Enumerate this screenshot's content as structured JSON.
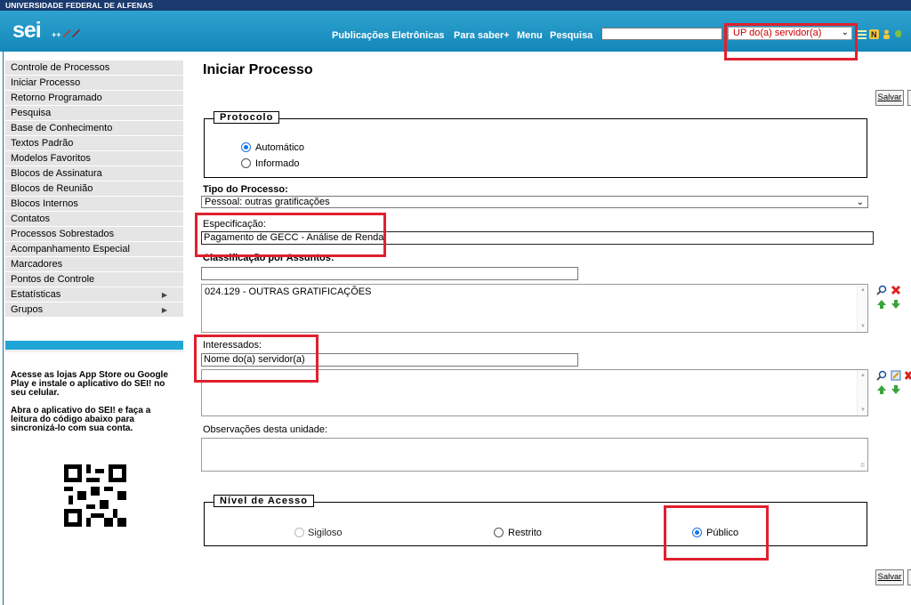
{
  "header": {
    "org_name": "UNIVERSIDADE FEDERAL DE ALFENAS",
    "logo_text": "sei",
    "logo_suffix": "++",
    "links": [
      "Publicações Eletrônicas",
      "Para saber+",
      "Menu",
      "Pesquisa"
    ],
    "search_value": "",
    "unit_selected": "UP do(a) servidor(a)"
  },
  "menu": {
    "items": [
      "Controle de Processos",
      "Iniciar Processo",
      "Retorno Programado",
      "Pesquisa",
      "Base de Conhecimento",
      "Textos Padrão",
      "Modelos Favoritos",
      "Blocos de Assinatura",
      "Blocos de Reunião",
      "Blocos Internos",
      "Contatos",
      "Processos Sobrestados",
      "Acompanhamento Especial",
      "Marcadores",
      "Pontos de Controle",
      "Estatísticas",
      "Grupos"
    ]
  },
  "promo": {
    "line1": "Acesse as lojas App Store ou Google Play e instale o aplicativo do SEI! no seu celular.",
    "line2": "Abra o aplicativo do SEI! e faça a leitura do código abaixo para sincronizá-lo com sua conta."
  },
  "page": {
    "title": "Iniciar Processo",
    "save_label": "Salvar"
  },
  "protocolo": {
    "legend": "Protocolo",
    "options": [
      "Automático",
      "Informado"
    ],
    "selected": "Automático"
  },
  "form": {
    "tipo_label": "Tipo do Processo:",
    "tipo_value": "Pessoal: outras gratificações",
    "especificacao_label": "Especificação:",
    "especificacao_value": "Pagamento de GECC - Análise de Renda",
    "classificacao_label": "Classificação por Assuntos:",
    "classificacao_input": "",
    "classificacao_items": [
      "024.129 - OUTRAS GRATIFICAÇÕES"
    ],
    "interessados_label": "Interessados:",
    "interessados_value": "Nome do(a) servidor(a)",
    "observacoes_label": "Observações desta unidade:",
    "observacoes_value": ""
  },
  "nivel": {
    "legend": "Nível de Acesso",
    "options": [
      "Sigiloso",
      "Restrito",
      "Público"
    ],
    "selected": "Público"
  },
  "colors": {
    "header_blue": "#1f95c6",
    "highlight_red": "#e0202e",
    "radio_blue": "#1a73e8"
  }
}
